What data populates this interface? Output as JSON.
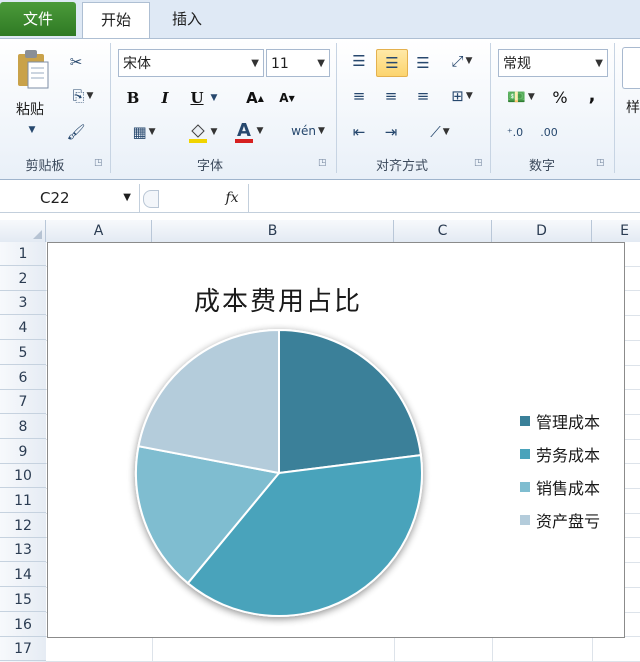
{
  "tabs": {
    "file": "文件",
    "home": "开始",
    "insert": "插入"
  },
  "ribbon": {
    "clipboard": {
      "label": "剪贴板",
      "paste": "粘贴"
    },
    "font": {
      "label": "字体",
      "font_name": "宋体",
      "font_size": "11",
      "bold": "B",
      "italic": "I",
      "underline": "U"
    },
    "alignment": {
      "label": "对齐方式"
    },
    "number": {
      "label": "数字",
      "format": "常规",
      "percent": "%",
      "comma": ","
    },
    "styles": {
      "partial": "样"
    }
  },
  "formula_bar": {
    "name_box": "C22",
    "fx": "fx",
    "formula": ""
  },
  "columns": [
    "A",
    "B",
    "C",
    "D",
    "E"
  ],
  "rows": [
    "1",
    "2",
    "3",
    "4",
    "5",
    "6",
    "7",
    "8",
    "9",
    "10",
    "11",
    "12",
    "13",
    "14",
    "15",
    "16",
    "17"
  ],
  "chart_data": {
    "type": "pie",
    "title": "成本费用占比",
    "categories": [
      "管理成本",
      "劳务成本",
      "销售成本",
      "资产盘亏"
    ],
    "values": [
      23,
      38,
      17,
      22
    ],
    "colors": [
      "#3a8099",
      "#4aa3bb",
      "#7fbdd0",
      "#b4ccdb"
    ],
    "legend_position": "right"
  }
}
